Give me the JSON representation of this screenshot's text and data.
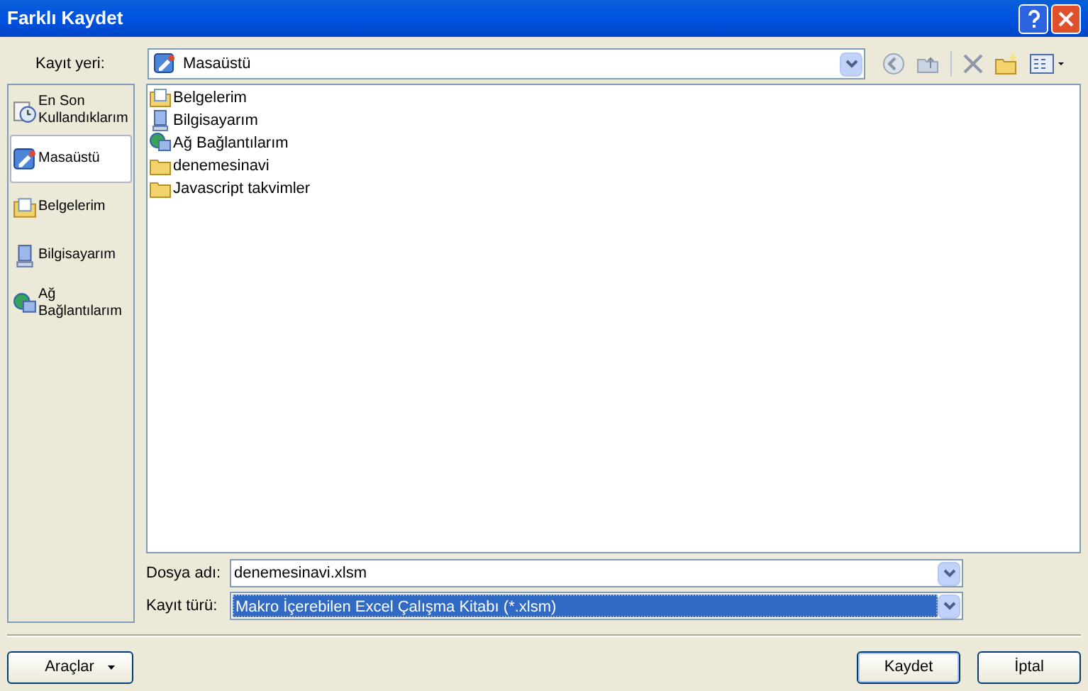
{
  "window": {
    "title": "Farklı Kaydet"
  },
  "location": {
    "label": "Kayıt yeri:",
    "value": "Masaüstü",
    "kind": "desktop"
  },
  "places": [
    {
      "label": "En Son Kullandıklarım",
      "kind": "recent",
      "selected": false
    },
    {
      "label": "Masaüstü",
      "kind": "desktop",
      "selected": true
    },
    {
      "label": "Belgelerim",
      "kind": "documents",
      "selected": false
    },
    {
      "label": "Bilgisayarım",
      "kind": "computer",
      "selected": false
    },
    {
      "label": "Ağ Bağlantılarım",
      "kind": "network",
      "selected": false
    }
  ],
  "files": [
    {
      "name": "Belgelerim",
      "kind": "documents"
    },
    {
      "name": "Bilgisayarım",
      "kind": "computer"
    },
    {
      "name": "Ağ Bağlantılarım",
      "kind": "network"
    },
    {
      "name": "denemesinavi",
      "kind": "folder"
    },
    {
      "name": "Javascript takvimler",
      "kind": "folder"
    }
  ],
  "file_name": {
    "label": "Dosya adı:",
    "value": "denemesinavi.xlsm"
  },
  "file_type": {
    "label": "Kayıt türü:",
    "value": "Makro İçerebilen Excel Çalışma Kitabı (*.xlsm)"
  },
  "buttons": {
    "tools": "Araçlar",
    "save": "Kaydet",
    "cancel": "İptal"
  }
}
